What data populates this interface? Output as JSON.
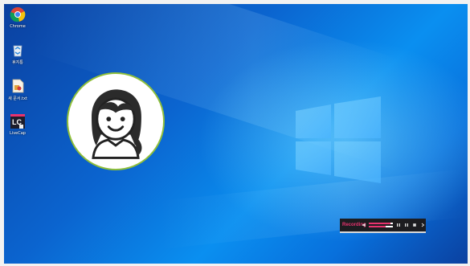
{
  "desktop": {
    "icons": [
      {
        "name": "chrome",
        "label": "Chrome",
        "icon": "chrome-icon"
      },
      {
        "name": "recycle-bin",
        "label": "휴지통",
        "icon": "recycle-bin-icon"
      },
      {
        "name": "document",
        "label": "새 문서.txt",
        "icon": "document-icon"
      },
      {
        "name": "lc-app",
        "label": "LiveCap",
        "icon": "lc-app-icon"
      }
    ]
  },
  "avatar": {
    "icon": "girl-avatar-icon"
  },
  "recorder": {
    "label": "Recording",
    "volume_icon": "speaker-icon",
    "level_1": 0.9,
    "level_2": 0.7,
    "buttons": [
      "pause-icon",
      "pause-icon",
      "stop-icon",
      "next-icon"
    ],
    "accent": "#e8336e"
  },
  "colors": {
    "wallpaper": "#0a6fd8",
    "frame": "#f2f2f2"
  }
}
